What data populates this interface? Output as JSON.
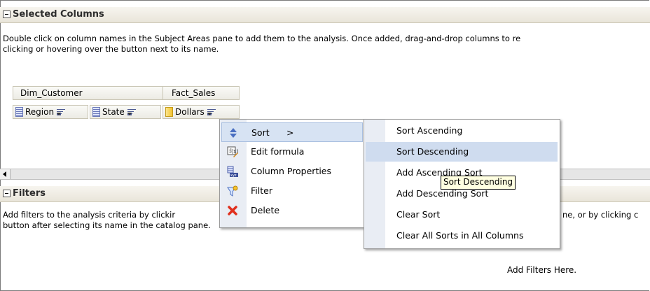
{
  "selected_columns": {
    "title": "Selected Columns",
    "description_line1": "Double click on column names in the Subject Areas pane to add them to the analysis. Once added, drag-and-drop columns to re",
    "description_line2": "clicking or hovering over the button next to its name.",
    "groups": [
      {
        "label": "Dim_Customer"
      },
      {
        "label": "Fact_Sales"
      }
    ],
    "columns": [
      {
        "label": "Region",
        "icon": "attribute-column-icon"
      },
      {
        "label": "State",
        "icon": "attribute-column-icon"
      },
      {
        "label": "Dollars",
        "icon": "measure-column-icon"
      }
    ]
  },
  "filters": {
    "title": "Filters",
    "description_line1_left": "Add filters to the analysis criteria by clickir",
    "description_line1_right": "ne, or by clicking c",
    "description_line2": "button after selecting its name in the catalog pane.",
    "empty_hint": "Add Filters Here."
  },
  "context_menu": {
    "items": [
      {
        "label": "Sort",
        "icon": "sort-icon",
        "submenu_arrow": ">"
      },
      {
        "label": "Edit formula",
        "icon": "edit-formula-icon"
      },
      {
        "label": "Column Properties",
        "icon": "column-properties-icon"
      },
      {
        "label": "Filter",
        "icon": "filter-icon"
      },
      {
        "label": "Delete",
        "icon": "delete-icon"
      }
    ]
  },
  "sort_submenu": {
    "items": [
      {
        "label": "Sort Ascending"
      },
      {
        "label": "Sort Descending"
      },
      {
        "label": "Add Ascending Sort"
      },
      {
        "label": "Add Descending Sort"
      },
      {
        "label": "Clear Sort"
      },
      {
        "label": "Clear All Sorts in All Columns"
      }
    ],
    "highlighted": "Sort Descending"
  },
  "tooltip": {
    "text": "Sort Descending"
  },
  "colors": {
    "menu_gutter": "#e9edf4",
    "highlight": "#cfdcef",
    "tooltip_bg": "#ffffe1",
    "delete_red": "#e0301e"
  }
}
